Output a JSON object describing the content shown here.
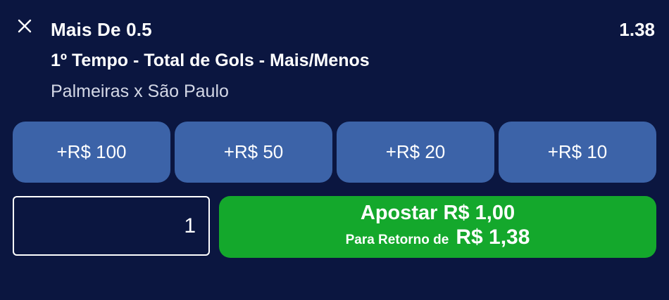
{
  "selection": {
    "market": "Mais De 0.5",
    "odds": "1.38",
    "bet_type": "1º Tempo - Total de Gols - Mais/Menos",
    "match": "Palmeiras x São Paulo"
  },
  "quick_stakes": [
    "+R$ 100",
    "+R$ 50",
    "+R$ 20",
    "+R$ 10"
  ],
  "stake_input": {
    "value": "1"
  },
  "bet_button": {
    "label": "Apostar R$ 1,00",
    "return_label": "Para Retorno de",
    "return_value": "R$ 1,38"
  },
  "icons": {
    "close": "close-icon"
  },
  "colors": {
    "background": "#0b1640",
    "quick_button": "#3c63a8",
    "bet_button": "#14a82c"
  }
}
